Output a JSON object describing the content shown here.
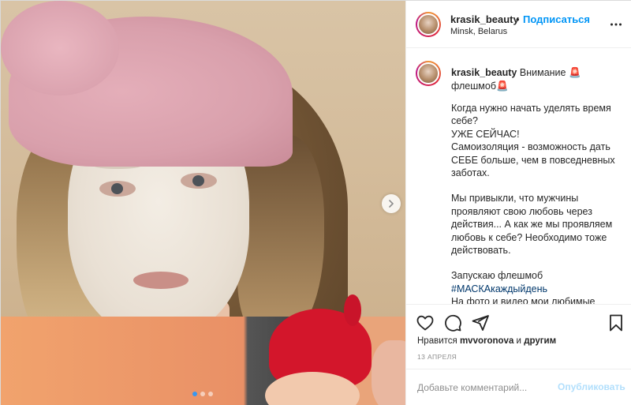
{
  "post": {
    "username": "krasik_beauty",
    "follow_label": "Подписаться",
    "separator": "•",
    "location": "Minsk, Belarus"
  },
  "caption": {
    "username": "krasik_beauty",
    "lead": "Внимание 🚨флешмоб🚨",
    "paragraphs": [
      [
        "Когда нужно начать уделять время себе?",
        "УЖЕ СЕЙЧАС!",
        "Самоизоляция - возможность дать СЕБЕ больше, чем в повседневных заботах."
      ],
      [
        "Мы привыкли, что мужчины проявляют свою любовь через действия... А как же мы проявляем любовь к себе? Необходимо тоже действовать."
      ]
    ],
    "flashmob_line": "Запускаю флешмоб",
    "hashtag": "#МАСКАкаждыйдень",
    "tail": "На фото и видео мои любимые масочки и наши семейные ритуалы"
  },
  "likes": {
    "prefix": "Нравится",
    "user": "mvvoronova",
    "and": "и",
    "others": "другим"
  },
  "date": "13 апреля",
  "comment": {
    "placeholder": "Добавьте комментарий...",
    "post_label": "Опубликовать"
  },
  "carousel": {
    "dots": 3,
    "active": 0
  },
  "colors": {
    "link": "#0095f6",
    "hashtag": "#00376b",
    "post_disabled": "#b2dffc",
    "carousel_active": "#3897f0"
  }
}
